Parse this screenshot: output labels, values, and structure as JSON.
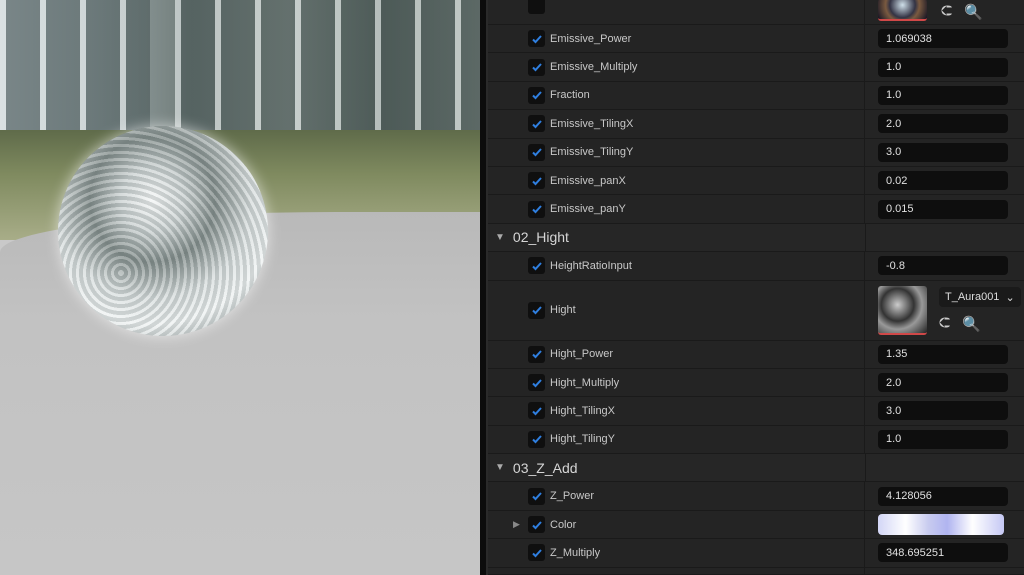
{
  "viewport": {
    "description_alt": "Material preview viewport"
  },
  "rows_a": [
    {
      "label": "Emissive_Power",
      "value": "1.069038"
    },
    {
      "label": "Emissive_Multiply",
      "value": "1.0"
    },
    {
      "label": "Fraction",
      "value": "1.0"
    },
    {
      "label": "Emissive_TilingX",
      "value": "2.0"
    },
    {
      "label": "Emissive_TilingY",
      "value": "3.0"
    },
    {
      "label": "Emissive_panX",
      "value": "0.02"
    },
    {
      "label": "Emissive_panY",
      "value": "0.015"
    }
  ],
  "cat_hight": {
    "title": "02_Hight"
  },
  "height_ratio": {
    "label": "HeightRatioInput",
    "value": "-0.8"
  },
  "hight_tex": {
    "label": "Hight",
    "asset": "T_Aura001"
  },
  "rows_b": [
    {
      "label": "Hight_Power",
      "value": "1.35"
    },
    {
      "label": "Hight_Multiply",
      "value": "2.0"
    },
    {
      "label": "Hight_TilingX",
      "value": "3.0"
    },
    {
      "label": "Hight_TilingY",
      "value": "1.0"
    }
  ],
  "cat_z": {
    "title": "03_Z_Add"
  },
  "z_power": {
    "label": "Z_Power",
    "value": "4.128056"
  },
  "color": {
    "label": "Color"
  },
  "z_multiply": {
    "label": "Z_Multiply",
    "value": "348.695251"
  },
  "colors": {
    "accent": "#2f7fe0",
    "panel": "#242424"
  }
}
